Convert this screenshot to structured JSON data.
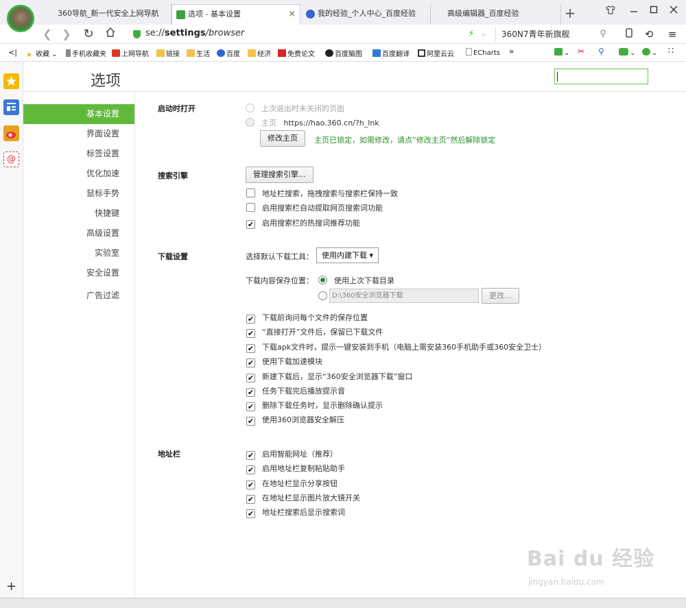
{
  "tabs": [
    {
      "title": "360导航_新一代安全上网导航"
    },
    {
      "title": "选项 - 基本设置",
      "close": "×"
    },
    {
      "title": "我的经验_个人中心_百度经验"
    },
    {
      "title": "高级编辑器_百度经验"
    }
  ],
  "new_tab": "+",
  "address": {
    "url_prefix": "se://",
    "url_bold": "settings",
    "url_suffix": "/browser"
  },
  "search_box": {
    "text": "360N7青年新旗舰"
  },
  "bookmarks": [
    "收藏",
    "手机收藏夹",
    "上网导航",
    "链接",
    "生活",
    "百度",
    "经济",
    "免费论文",
    "百度脑图",
    "百度翻译",
    "阿里云云",
    "ECharts"
  ],
  "bookmarks_more": "»",
  "options": {
    "title": "选项"
  },
  "menu": [
    "基本设置",
    "界面设置",
    "标签设置",
    "优化加速",
    "鼠标手势",
    "快捷键",
    "高级设置",
    "实验室",
    "安全设置",
    "广告过滤"
  ],
  "startup": {
    "heading": "启动时打开",
    "option1": "上次退出时未关闭的页面",
    "option2_label": "主页",
    "option2_url": "https://hao.360.cn/?h_lnk",
    "change_btn": "修改主页",
    "lock_note": "主页已锁定，如需修改，请点“修改主页”然后解除锁定"
  },
  "search": {
    "heading": "搜索引擎",
    "manage_btn": "管理搜索引擎...",
    "checks": [
      {
        "label": "地址栏搜索，拖拽搜索与搜索栏保持一致",
        "checked": false
      },
      {
        "label": "启用搜索栏自动提取网页搜索词功能",
        "checked": false
      },
      {
        "label": "启用搜索栏的热搜词推荐功能",
        "checked": true
      }
    ]
  },
  "download": {
    "heading": "下载设置",
    "tool_label": "选择默认下载工具：",
    "tool_value": "使用内建下载",
    "location_label": "下载内容保存位置：",
    "use_last_dir": "使用上次下载目录",
    "path_value": "D:\\360安全浏览器下载",
    "change_btn": "更改...",
    "checks": [
      {
        "label": "下载前询问每个文件的保存位置",
        "checked": true
      },
      {
        "label": "“直接打开”文件后，保留已下载文件",
        "checked": true
      },
      {
        "label": "下载apk文件时，提示一键安装到手机（电脑上需安装360手机助手或360安全卫士）",
        "checked": true
      },
      {
        "label": "使用下载加速模块",
        "checked": true
      },
      {
        "label": "新建下载后，显示“360安全浏览器下载”窗口",
        "checked": true
      },
      {
        "label": "任务下载完后播放提示音",
        "checked": true
      },
      {
        "label": "删除下载任务时，显示删除确认提示",
        "checked": true
      },
      {
        "label": "使用360浏览器安全解压",
        "checked": true
      }
    ]
  },
  "addressbar": {
    "heading": "地址栏",
    "checks": [
      {
        "label": "启用智能网址（推荐）",
        "checked": true
      },
      {
        "label": "启用地址栏复制粘贴助手",
        "checked": true
      },
      {
        "label": "在地址栏显示分享按钮",
        "checked": true
      },
      {
        "label": "在地址栏显示图片放大镜开关",
        "checked": true
      },
      {
        "label": "地址栏搜索后显示搜索词",
        "checked": true
      }
    ]
  },
  "watermark": {
    "line1": "Bai du 经验",
    "line2": "jingyan.baidu.com"
  },
  "sidebar_add": "+"
}
